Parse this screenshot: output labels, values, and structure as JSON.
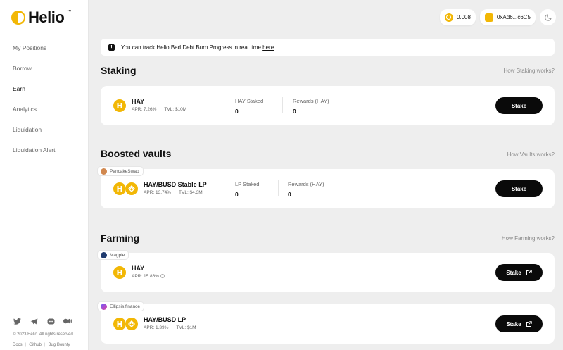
{
  "app": {
    "logo_text": "Helio",
    "tm": "™"
  },
  "sidebar": {
    "items": [
      {
        "label": "My Positions"
      },
      {
        "label": "Borrow"
      },
      {
        "label": "Earn"
      },
      {
        "label": "Analytics"
      },
      {
        "label": "Liquidation"
      },
      {
        "label": "Liquidation Alert"
      }
    ],
    "active": "Earn",
    "socials": [
      "twitter-icon",
      "telegram-icon",
      "discord-icon",
      "medium-icon"
    ],
    "copyright": "© 2023 Helio. All rights reserved.",
    "footer_links": [
      "Docs",
      "Github",
      "Bug Bounty"
    ]
  },
  "topbar": {
    "balance": "0.008",
    "wallet": "0xAd6...c6C5",
    "theme_icon": "moon-icon"
  },
  "alert": {
    "text": "You can track Helio Bad Debt Burn Progress in real time",
    "link": "here"
  },
  "staking": {
    "title": "Staking",
    "help": "How Staking works?",
    "card": {
      "name": "HAY",
      "apr": "APR: 7.26%",
      "tvl": "TVL: $10M",
      "stat1_label": "HAY Staked",
      "stat1_value": "0",
      "stat2_label": "Rewards (HAY)",
      "stat2_value": "0",
      "button": "Stake"
    }
  },
  "vaults": {
    "title": "Boosted vaults",
    "help": "How Vaults works?",
    "card": {
      "tag": "PancakeSwap",
      "name": "HAY/BUSD Stable LP",
      "apr": "APR: 13.74%",
      "tvl": "TVL: $4.3M",
      "stat1_label": "LP Staked",
      "stat1_value": "0",
      "stat2_label": "Rewards (HAY)",
      "stat2_value": "0",
      "button": "Stake"
    }
  },
  "farming": {
    "title": "Farming",
    "help": "How Farming works?",
    "cards": [
      {
        "tag": "Magpie",
        "name": "HAY",
        "apr": "APR: 15.86%",
        "button": "Stake"
      },
      {
        "tag": "Ellipsis.finance",
        "name": "HAY/BUSD LP",
        "apr": "APR: 1.39%",
        "tvl": "TVL: $1M",
        "button": "Stake"
      }
    ]
  },
  "colors": {
    "brand": "#f2b705",
    "button": "#0a0a0a",
    "background": "#eeeeee"
  }
}
